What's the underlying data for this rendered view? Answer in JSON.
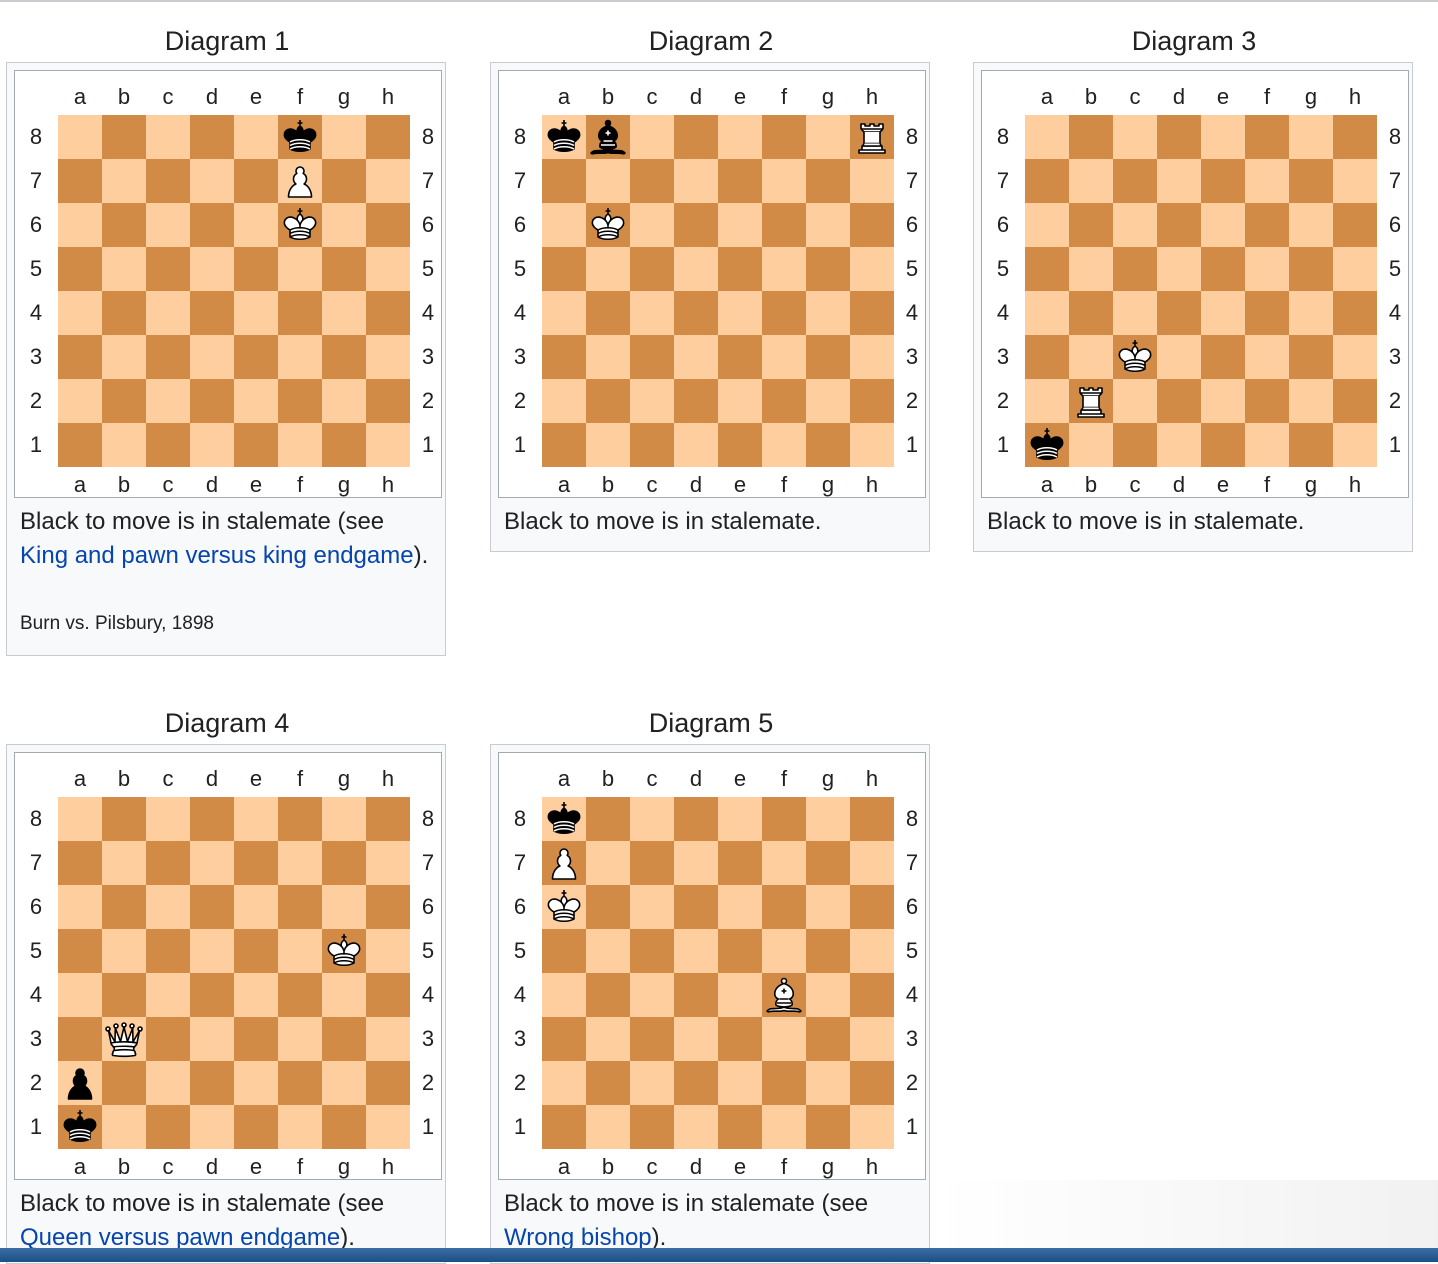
{
  "files": [
    "a",
    "b",
    "c",
    "d",
    "e",
    "f",
    "g",
    "h"
  ],
  "ranks": [
    "8",
    "7",
    "6",
    "5",
    "4",
    "3",
    "2",
    "1"
  ],
  "colors": {
    "light_square": "#ffce9e",
    "dark_square": "#d18b47",
    "link": "#0645ad"
  },
  "diagrams": [
    {
      "title": "Diagram 1",
      "caption_before": "Black to move is in stalemate (see ",
      "caption_link": "King and pawn versus king endgame",
      "caption_after": ").",
      "source": "Burn vs. Pilsbury, 1898",
      "pieces": [
        {
          "square": "f8",
          "piece": "black-king"
        },
        {
          "square": "f7",
          "piece": "white-pawn"
        },
        {
          "square": "f6",
          "piece": "white-king"
        }
      ]
    },
    {
      "title": "Diagram 2",
      "caption_before": "Black to move is in stalemate.",
      "caption_link": "",
      "caption_after": "",
      "source": "",
      "pieces": [
        {
          "square": "a8",
          "piece": "black-king"
        },
        {
          "square": "b8",
          "piece": "black-bishop"
        },
        {
          "square": "h8",
          "piece": "white-rook"
        },
        {
          "square": "b6",
          "piece": "white-king"
        }
      ]
    },
    {
      "title": "Diagram 3",
      "caption_before": "Black to move is in stalemate.",
      "caption_link": "",
      "caption_after": "",
      "source": "",
      "pieces": [
        {
          "square": "c3",
          "piece": "white-king"
        },
        {
          "square": "b2",
          "piece": "white-rook"
        },
        {
          "square": "a1",
          "piece": "black-king"
        }
      ]
    },
    {
      "title": "Diagram 4",
      "caption_before": "Black to move is in stalemate (see ",
      "caption_link": "Queen versus pawn endgame",
      "caption_after": ").",
      "source": "",
      "pieces": [
        {
          "square": "g5",
          "piece": "white-king"
        },
        {
          "square": "b3",
          "piece": "white-queen"
        },
        {
          "square": "a2",
          "piece": "black-pawn"
        },
        {
          "square": "a1",
          "piece": "black-king"
        }
      ]
    },
    {
      "title": "Diagram 5",
      "caption_before": "Black to move is in stalemate (see ",
      "caption_link": "Wrong bishop",
      "caption_after": ").",
      "source": "",
      "pieces": [
        {
          "square": "a8",
          "piece": "black-king"
        },
        {
          "square": "a7",
          "piece": "white-pawn"
        },
        {
          "square": "a6",
          "piece": "white-king"
        },
        {
          "square": "f4",
          "piece": "white-bishop"
        }
      ]
    }
  ]
}
